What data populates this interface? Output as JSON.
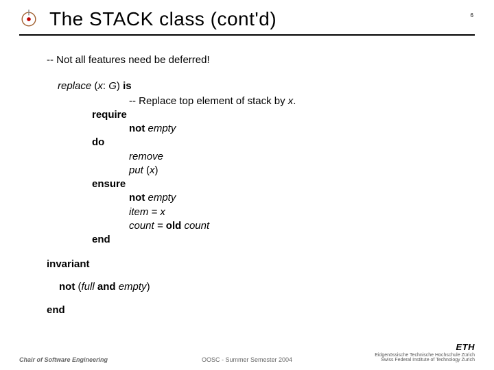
{
  "header": {
    "title": "The STACK class (cont'd)",
    "page_number": "6"
  },
  "body": {
    "comment": "-- Not all features need be deferred!",
    "sig": {
      "name": "replace",
      "open": " (",
      "arg": "x",
      "colon": ": ",
      "type": "G",
      "close": ") ",
      "is": "is"
    },
    "routine": {
      "comment_prefix": "-- Replace top element of stack by ",
      "comment_var": "x",
      "comment_suffix": ".",
      "require": "require",
      "pre1_not": "not",
      "pre1_rest": " empty",
      "do": "do",
      "body1": "remove",
      "body2_put": "put",
      "body2_open": " (",
      "body2_arg": "x",
      "body2_close": ")",
      "ensure": "ensure",
      "post1_not": "not",
      "post1_rest": " empty",
      "post2": "item = x",
      "post3_left": "count = ",
      "post3_old": "old",
      "post3_right": " count",
      "end": "end"
    },
    "invariant": {
      "kw": "invariant",
      "not": "not",
      "open": " (",
      "full": "full",
      "and": " and ",
      "empty": "empty",
      "close": ")"
    },
    "end": "end"
  },
  "footer": {
    "left": "Chair of Software Engineering",
    "center": "OOSC - Summer Semester 2004",
    "right": {
      "logo": "ETH",
      "line1": "Eidgenössische Technische Hochschule Zürich",
      "line2": "Swiss Federal Institute of Technology Zurich"
    }
  }
}
